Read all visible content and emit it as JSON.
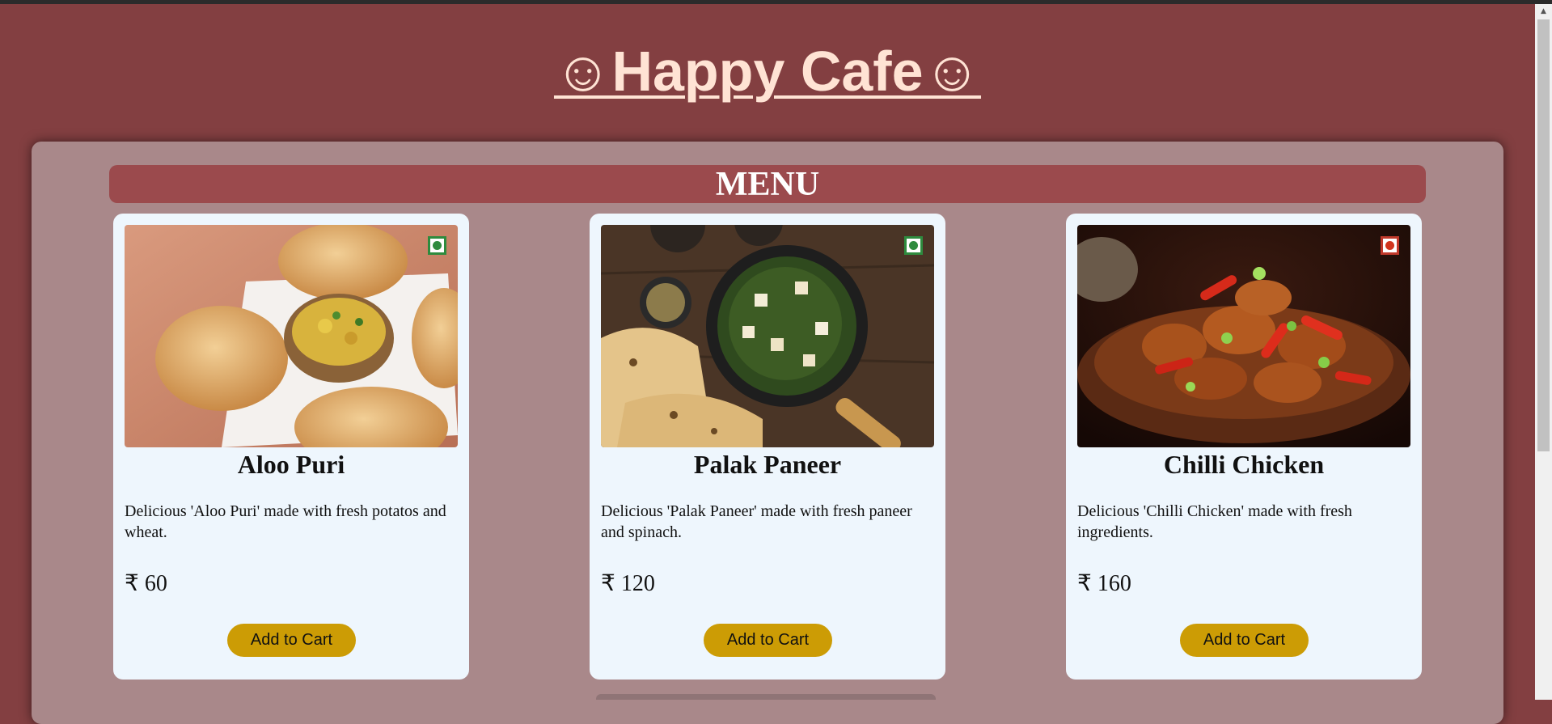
{
  "site": {
    "title": "☺Happy Cafe☺"
  },
  "menu": {
    "heading": "MENU",
    "items": [
      {
        "name": "Aloo Puri",
        "description": "Delicious 'Aloo Puri' made with fresh potatos and wheat.",
        "price": "₹ 60",
        "button_label": "Add to Cart",
        "diet": "veg",
        "image": "aloo-puri-photo"
      },
      {
        "name": "Palak Paneer",
        "description": "Delicious 'Palak Paneer' made with fresh paneer and spinach.",
        "price": "₹ 120",
        "button_label": "Add to Cart",
        "diet": "veg",
        "image": "palak-paneer-photo"
      },
      {
        "name": "Chilli Chicken",
        "description": "Delicious 'Chilli Chicken' made with fresh ingredients.",
        "price": "₹ 160",
        "button_label": "Add to Cart",
        "diet": "non-veg",
        "image": "chilli-chicken-photo"
      }
    ]
  },
  "colors": {
    "page_background": "#833f41",
    "title_text": "#ffe3d4",
    "panel_background": "#a9888a",
    "menu_header": "#9b4a4d",
    "card_background": "#eef6fd",
    "button": "#cc9c05",
    "veg_mark": "#2e8b3e",
    "nonveg_mark": "#c0392b"
  }
}
